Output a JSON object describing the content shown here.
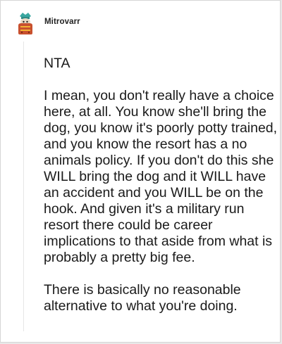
{
  "post": {
    "username": "Mitrovarr",
    "avatar_icon": "snoo-avatar-icon",
    "paragraphs": [
      "NTA",
      "I mean, you don't really have a choice here, at all. You know she'll bring the dog, you know it's poorly potty trained, and you know the resort has a no animals policy. If you don't do this she WILL bring the dog and it WILL have an accident and you WILL be on the hook. And given it's a military run resort there could be career implications to that aside from what is probably a pretty big fee.",
      "There is basically no reasonable alternative to what you're doing."
    ]
  },
  "colors": {
    "background": "#ffffff",
    "text": "#1a1a1a",
    "avatar_body": "#c8502e",
    "avatar_hat": "#3aa7a0"
  }
}
